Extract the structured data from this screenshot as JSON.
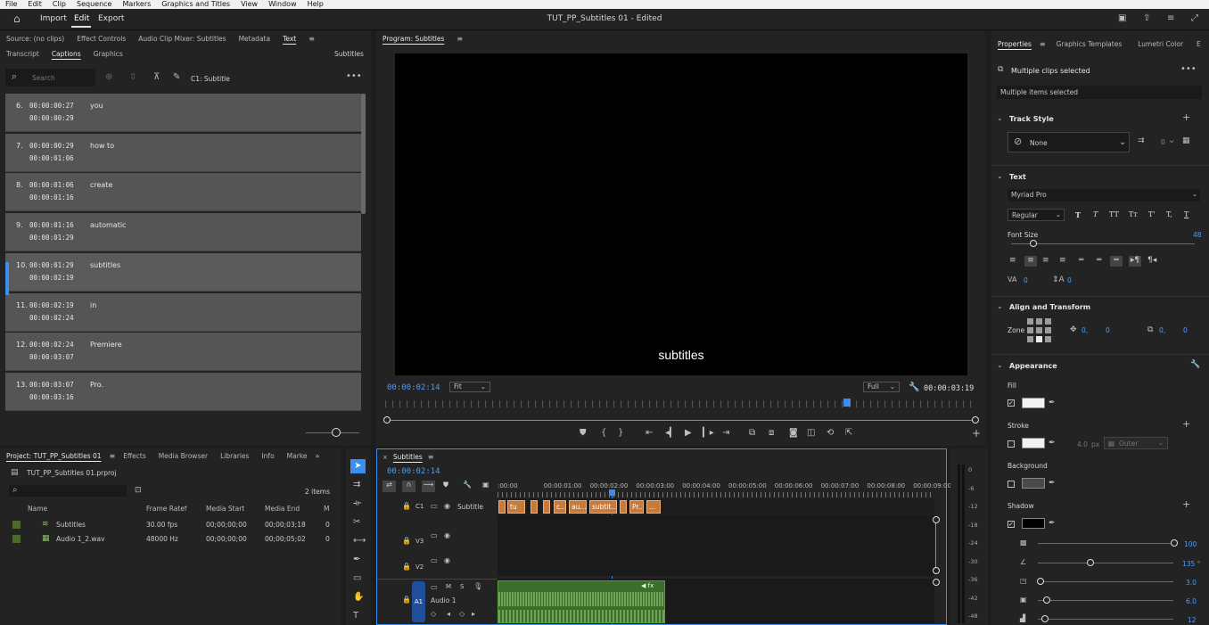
{
  "os_menu": [
    "File",
    "Edit",
    "Clip",
    "Sequence",
    "Markers",
    "Graphics and Titles",
    "View",
    "Window",
    "Help"
  ],
  "appbar": {
    "nav": [
      "Import",
      "Edit",
      "Export"
    ],
    "title": "TUT_PP_Subtitles 01 - Edited"
  },
  "source_panel": {
    "tabs": [
      "Source: (no clips)",
      "Effect Controls",
      "Audio Clip Mixer: Subtitles",
      "Metadata",
      "Text"
    ],
    "subtabs": [
      "Transcript",
      "Captions",
      "Graphics"
    ],
    "right_label": "Subtitles",
    "search_placeholder": "Search",
    "track_label": "C1: Subtitle",
    "captions": [
      {
        "num": "6.",
        "start": "00:00:00:27",
        "end": "00:00:00:29",
        "text": "you"
      },
      {
        "num": "7.",
        "start": "00:00:00:29",
        "end": "00:00:01:06",
        "text": "how to"
      },
      {
        "num": "8.",
        "start": "00:00:01:06",
        "end": "00:00:01:16",
        "text": "create"
      },
      {
        "num": "9.",
        "start": "00:00:01:16",
        "end": "00:00:01:29",
        "text": "automatic"
      },
      {
        "num": "10.",
        "start": "00:00:01:29",
        "end": "00:00:02:19",
        "text": "subtitles"
      },
      {
        "num": "11.",
        "start": "00:00:02:19",
        "end": "00:00:02:24",
        "text": "in"
      },
      {
        "num": "12.",
        "start": "00:00:02:24",
        "end": "00:00:03:07",
        "text": "Premiere"
      },
      {
        "num": "13.",
        "start": "00:00:03:07",
        "end": "00:00:03:16",
        "text": "Pro."
      }
    ]
  },
  "program": {
    "title": "Program: Subtitles",
    "subtitle_text": "subtitles",
    "timecode": "00:00:02:14",
    "fit": "Fit",
    "quality": "Full",
    "duration": "00:00:03:19",
    "playhead": 0.78
  },
  "project": {
    "tabs": [
      "Project: TUT_PP_Subtitles 01",
      "Effects",
      "Media Browser",
      "Libraries",
      "Info",
      "Marke"
    ],
    "file": "TUT_PP_Subtitles 01.prproj",
    "items_count": "2 items",
    "columns": [
      "Name",
      "Frame Rate",
      "Media Start",
      "Media End",
      "M"
    ],
    "rows": [
      {
        "name": "Subtitles",
        "rate": "30.00 fps",
        "start": "00;00;00;00",
        "end": "00;00;03;18",
        "m": "0"
      },
      {
        "name": "Audio 1_2.wav",
        "rate": "48000 Hz",
        "start": "00;00;00;00",
        "end": "00;00;05;02",
        "m": "0"
      }
    ]
  },
  "timeline": {
    "title": "Subtitles",
    "timecode": "00:00:02:14",
    "ruler": [
      ":00:00",
      "00:00:01:00",
      "00:00:02:00",
      "00:00:03:00",
      "00:00:04:00",
      "00:00:05:00",
      "00:00:06:00",
      "00:00:07:00",
      "00:00:08:00",
      "00:00:09:00"
    ],
    "tracks": {
      "c1": "C1",
      "c1_name": "Subtitle",
      "v3": "V3",
      "v2": "V2",
      "a1": "A1",
      "a1_name": "Audio 1"
    },
    "clips": [
      "",
      "tu",
      "",
      "",
      "c...",
      "au...",
      "subtit...",
      "",
      "Pr...",
      "..."
    ],
    "meter_labels": [
      "0",
      "-6",
      "-12",
      "-18",
      "-24",
      "-30",
      "-36",
      "-42",
      "-48"
    ]
  },
  "properties": {
    "tabs": [
      "Properties",
      "Graphics Templates",
      "Lumetri Color",
      "E"
    ],
    "multiple": "Multiple clips selected",
    "multiple_items": "Multiple items selected",
    "track_style": "Track Style",
    "style_none": "None",
    "style_count": "0",
    "text_section": "Text",
    "font": "Myriad Pro",
    "weight": "Regular",
    "font_size_label": "Font Size",
    "font_size": "48",
    "tracking": "0",
    "leading": "0",
    "align_section": "Align and Transform",
    "zone": "Zone",
    "pos_x": "0,",
    "pos_y": "0",
    "scale_x": "0,",
    "scale_y": "0",
    "appearance": "Appearance",
    "fill": "Fill",
    "stroke": "Stroke",
    "stroke_size": "4.0",
    "stroke_unit": "px",
    "stroke_type": "Outer",
    "background": "Background",
    "shadow": "Shadow",
    "shadow_values": [
      "100",
      "135 °",
      "3.0",
      "6.0",
      "12"
    ]
  }
}
